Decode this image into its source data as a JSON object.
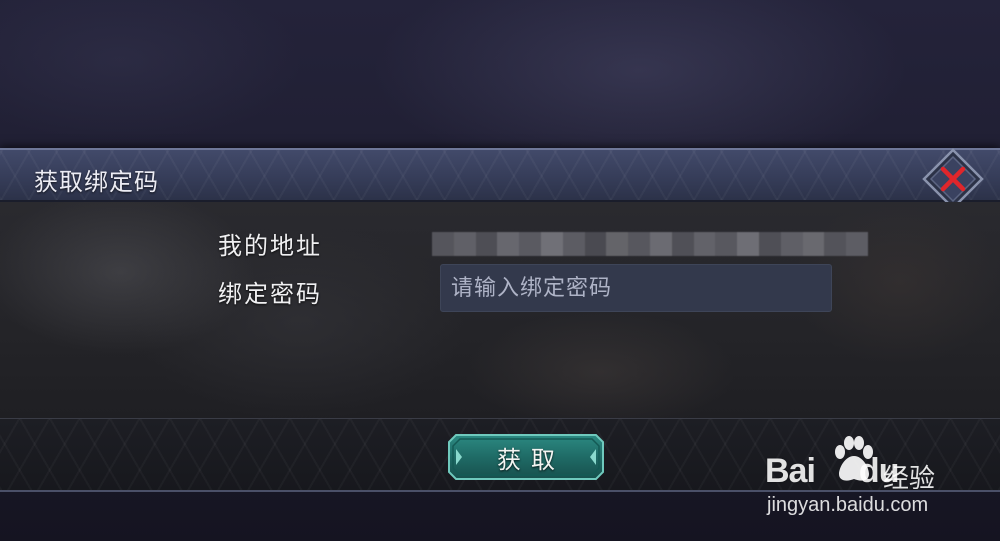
{
  "dialog": {
    "title": "获取绑定码",
    "close_icon": "close-x-icon",
    "address_label": "我的地址",
    "address_value": "",
    "password_label": "绑定密码",
    "password_placeholder": "请输入绑定密码",
    "password_value": "",
    "submit_label": "获取"
  },
  "watermark": {
    "logo_text": "Bai",
    "logo_suffix": "du",
    "paw_icon": "baidu-paw-icon",
    "product": "经验",
    "url": "jingyan.baidu.com"
  },
  "colors": {
    "title_bar": "#3a4260",
    "button_teal": "#1f6b66",
    "close_red": "#e0262b",
    "input_bg": "#33394c"
  }
}
